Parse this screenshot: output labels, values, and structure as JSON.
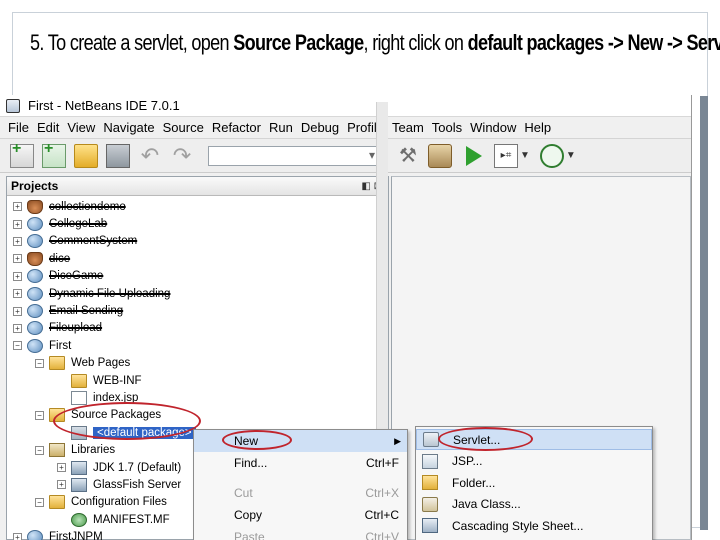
{
  "slide": {
    "step_number": "5.",
    "caption_prefix": "To create a servlet, open ",
    "caption_bold1": "Source Package",
    "caption_mid": ", right click on ",
    "caption_bold2": "default packages -> New -> Servlet"
  },
  "window": {
    "title": "First - NetBeans IDE 7.0.1"
  },
  "menubar": {
    "items": [
      "File",
      "Edit",
      "View",
      "Navigate",
      "Source",
      "Refactor",
      "Run",
      "Debug",
      "Profile",
      "Team",
      "Tools",
      "Window",
      "Help"
    ]
  },
  "toolbar": {
    "config_value": ""
  },
  "projects": {
    "title": "Projects",
    "header_buttons": "◧ ⊠",
    "tree": [
      {
        "label": "collectiondemo",
        "toggle": "+",
        "icon": "cup-icon",
        "struck": true,
        "indent": 0
      },
      {
        "label": "CollegeLab",
        "toggle": "+",
        "icon": "globe-icon",
        "struck": true,
        "indent": 0
      },
      {
        "label": "CommentSystem",
        "toggle": "+",
        "icon": "globe-icon",
        "struck": true,
        "indent": 0
      },
      {
        "label": "dice",
        "toggle": "+",
        "icon": "cup-icon",
        "struck": true,
        "indent": 0
      },
      {
        "label": "DiceGame",
        "toggle": "+",
        "icon": "globe-icon",
        "struck": true,
        "indent": 0
      },
      {
        "label": "Dynamic File Uploading",
        "toggle": "+",
        "icon": "globe-icon",
        "struck": true,
        "indent": 0
      },
      {
        "label": "Email Sending",
        "toggle": "+",
        "icon": "globe-icon",
        "struck": true,
        "indent": 0
      },
      {
        "label": "Fileupload",
        "toggle": "+",
        "icon": "globe-icon",
        "struck": true,
        "indent": 0
      },
      {
        "label": "First",
        "toggle": "−",
        "icon": "globe-icon",
        "struck": false,
        "indent": 0
      },
      {
        "label": "Web Pages",
        "toggle": "−",
        "icon": "folder-icon",
        "struck": false,
        "indent": 1
      },
      {
        "label": "WEB-INF",
        "toggle": "",
        "icon": "folder-icon",
        "struck": false,
        "indent": 2
      },
      {
        "label": "index.jsp",
        "toggle": "",
        "icon": "file-icon",
        "struck": false,
        "indent": 2
      },
      {
        "label": "Source Packages",
        "toggle": "−",
        "icon": "folder-icon",
        "struck": false,
        "indent": 1
      },
      {
        "label": "<default package>",
        "toggle": "",
        "icon": "package-icon",
        "struck": false,
        "indent": 2,
        "selected": true
      },
      {
        "label": "Libraries",
        "toggle": "−",
        "icon": "library-icon",
        "struck": false,
        "indent": 1
      },
      {
        "label": "JDK 1.7 (Default)",
        "toggle": "+",
        "icon": "jar-icon",
        "struck": false,
        "indent": 2
      },
      {
        "label": "GlassFish Server",
        "toggle": "+",
        "icon": "jar-icon",
        "struck": false,
        "indent": 2
      },
      {
        "label": "Configuration Files",
        "toggle": "−",
        "icon": "folder-icon",
        "struck": false,
        "indent": 1
      },
      {
        "label": "MANIFEST.MF",
        "toggle": "",
        "icon": "manifest-icon",
        "struck": false,
        "indent": 2
      },
      {
        "label": "FirstJNPM",
        "toggle": "+",
        "icon": "globe-icon",
        "struck": false,
        "indent": 0
      }
    ]
  },
  "context_menu": {
    "items": [
      {
        "label": "New",
        "accel": "",
        "submenu": true,
        "enabled": true,
        "highlighted": true
      },
      {
        "label": "Find...",
        "accel": "Ctrl+F",
        "submenu": false,
        "enabled": true,
        "highlighted": false
      },
      {
        "label": "Cut",
        "accel": "Ctrl+X",
        "submenu": false,
        "enabled": false,
        "highlighted": false
      },
      {
        "label": "Copy",
        "accel": "Ctrl+C",
        "submenu": false,
        "enabled": true,
        "highlighted": false
      },
      {
        "label": "Paste",
        "accel": "Ctrl+V",
        "submenu": false,
        "enabled": false,
        "highlighted": false
      }
    ]
  },
  "new_submenu": {
    "items": [
      {
        "label": "Servlet...",
        "icon": "servlet-icon",
        "highlighted": true
      },
      {
        "label": "JSP...",
        "icon": "jsp-icon",
        "highlighted": false
      },
      {
        "label": "Folder...",
        "icon": "folder-icon",
        "highlighted": false
      },
      {
        "label": "Java Class...",
        "icon": "java-class-icon",
        "highlighted": false
      },
      {
        "label": "Cascading Style Sheet...",
        "icon": "css-icon",
        "highlighted": false
      }
    ]
  },
  "colors": {
    "selection": "#2f64c6",
    "menu_highlight": "#cfe0f5",
    "annotation_red": "#c0242c"
  }
}
